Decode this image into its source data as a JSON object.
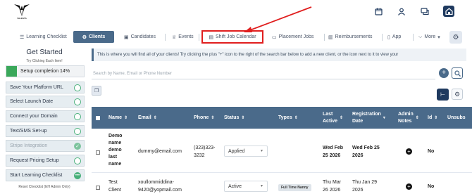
{
  "brand": {
    "logo_text": "VALESTA"
  },
  "top_icons": [
    "calendar-icon",
    "users-icon",
    "chat-icon",
    "home-icon"
  ],
  "nav": {
    "tabs": [
      {
        "label": "Learning Checklist",
        "icon": "list-icon"
      },
      {
        "label": "Clients",
        "icon": "gear-icon",
        "active": true
      },
      {
        "label": "Candidates",
        "icon": "briefcase-icon"
      },
      {
        "label": "Events",
        "icon": "trophy-icon"
      },
      {
        "label": "Shift Job Calendar",
        "icon": "calendar-icon",
        "highlighted": true
      },
      {
        "label": "Placement Jobs",
        "icon": "folder-icon"
      },
      {
        "label": "Reimbursements",
        "icon": "receipt-icon"
      },
      {
        "label": "App",
        "icon": "mobile-icon"
      },
      {
        "label": "More",
        "icon": "dropdown-icon"
      }
    ]
  },
  "sidebar": {
    "title": "Get Started",
    "subtitle": "Try Clicking Each Item!",
    "progress_label": "Setup completion 14%",
    "progress_percent": 14,
    "items": [
      {
        "label": "Save Your Platform URL",
        "state": "open"
      },
      {
        "label": "Select Launch Date",
        "state": "open"
      },
      {
        "label": "Connect your Domain",
        "state": "open"
      },
      {
        "label": "Text/SMS Set-up",
        "state": "open"
      },
      {
        "label": "Stripe Integration",
        "state": "done"
      },
      {
        "label": "Request Pricing Setup",
        "state": "open"
      },
      {
        "label": "Start Learning Checklist",
        "state": "in-progress"
      }
    ],
    "reset_label": "Reset Checklist (EH Admin Only)"
  },
  "info_banner": "This is where you will find all of your clients! Try clicking the plus \"+\" icon to the right of the search bar below to add a new client, or the icon next to it to view your",
  "search": {
    "placeholder": "Search by Name, Email or Phone Number"
  },
  "table": {
    "headers": {
      "name": "Name",
      "email": "Email",
      "phone": "Phone",
      "status": "Status",
      "types": "Types",
      "last_active_1": "Last",
      "last_active_2": "Active",
      "reg_1": "Registration",
      "reg_2": "Date",
      "notes_1": "Admin",
      "notes_2": "Notes",
      "id": "Id",
      "unsub": "Unsubs"
    },
    "rows": [
      {
        "name_lines": [
          "Demo",
          "name",
          "demo",
          "last",
          "name"
        ],
        "email": "dummy@email.com",
        "phone_lines": [
          "(323)323-",
          "3232"
        ],
        "status": "Applied",
        "type": "",
        "last_active_lines": [
          "Wed Feb",
          "25 2026"
        ],
        "reg_lines": [
          "Wed Feb 25",
          "2026"
        ],
        "id": "No"
      },
      {
        "name_lines": [
          "Test",
          "Client"
        ],
        "email_lines": [
          "xoullommiddina-",
          "9420@yopmail.com"
        ],
        "phone_lines": [],
        "status": "Active",
        "type": "Full Time Nanny",
        "last_active_lines": [
          "Thu Mar",
          "26 2026"
        ],
        "reg_lines": [
          "Thu Jan 29",
          "2026"
        ],
        "id": "No"
      }
    ]
  }
}
